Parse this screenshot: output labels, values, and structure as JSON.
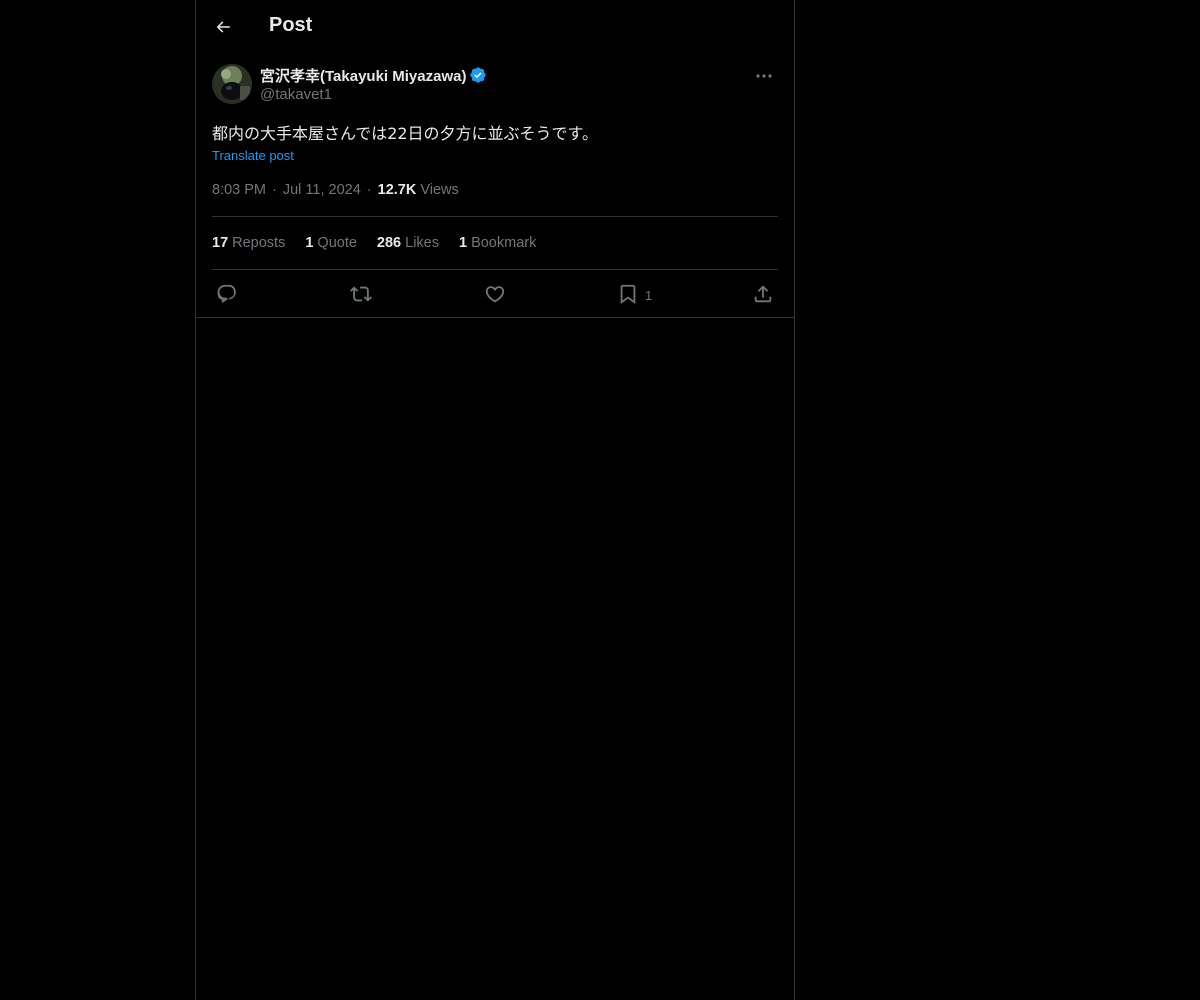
{
  "header": {
    "title": "Post"
  },
  "tweet": {
    "author": {
      "display_name": "宮沢孝幸(Takayuki Miyazawa)",
      "handle": "@takavet1",
      "verified": true
    },
    "text": "都内の大手本屋さんでは22日の夕方に並ぶそうです。",
    "translate_label": "Translate post",
    "time": "8:03 PM",
    "date": "Jul 11, 2024",
    "views_count": "12.7K",
    "views_label": "Views",
    "stats": {
      "reposts": {
        "count": "17",
        "label": "Reposts"
      },
      "quotes": {
        "count": "1",
        "label": "Quote"
      },
      "likes": {
        "count": "286",
        "label": "Likes"
      },
      "bookmarks": {
        "count": "1",
        "label": "Bookmark"
      }
    },
    "bookmark_action_count": "1"
  },
  "colors": {
    "background": "#000000",
    "text": "#e7e9ea",
    "secondary": "#71767b",
    "link": "#1d9bf0",
    "border": "#2f3336",
    "verified": "#1d9bf0"
  },
  "icons": [
    "back-arrow-icon",
    "verified-badge-icon",
    "more-icon",
    "reply-icon",
    "repost-icon",
    "like-icon",
    "bookmark-icon",
    "share-icon"
  ]
}
